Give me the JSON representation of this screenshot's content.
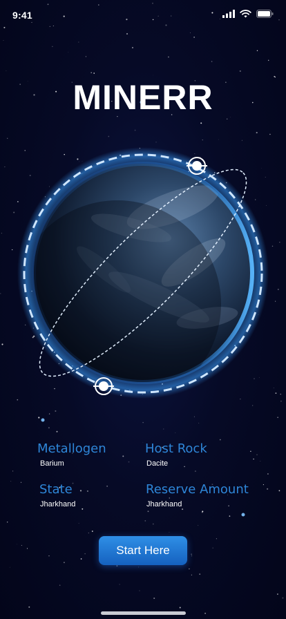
{
  "status_bar": {
    "time": "9:41",
    "icons": [
      "signal-icon",
      "wifi-icon",
      "battery-icon"
    ]
  },
  "app": {
    "title": "MINERR"
  },
  "info": {
    "metallogen": {
      "label": "Metallogen",
      "value": "Barium"
    },
    "host_rock": {
      "label": "Host Rock",
      "value": "Dacite"
    },
    "state": {
      "label": "State",
      "value": "Jharkhand"
    },
    "reserve_amount": {
      "label": "Reserve Amount",
      "value": "Jharkhand"
    }
  },
  "actions": {
    "start_label": "Start Here"
  },
  "colors": {
    "background": "#05081c",
    "label_blue": "#2e86d8",
    "button_blue": "#1f77d6",
    "orbit": "#cfe6ff"
  }
}
